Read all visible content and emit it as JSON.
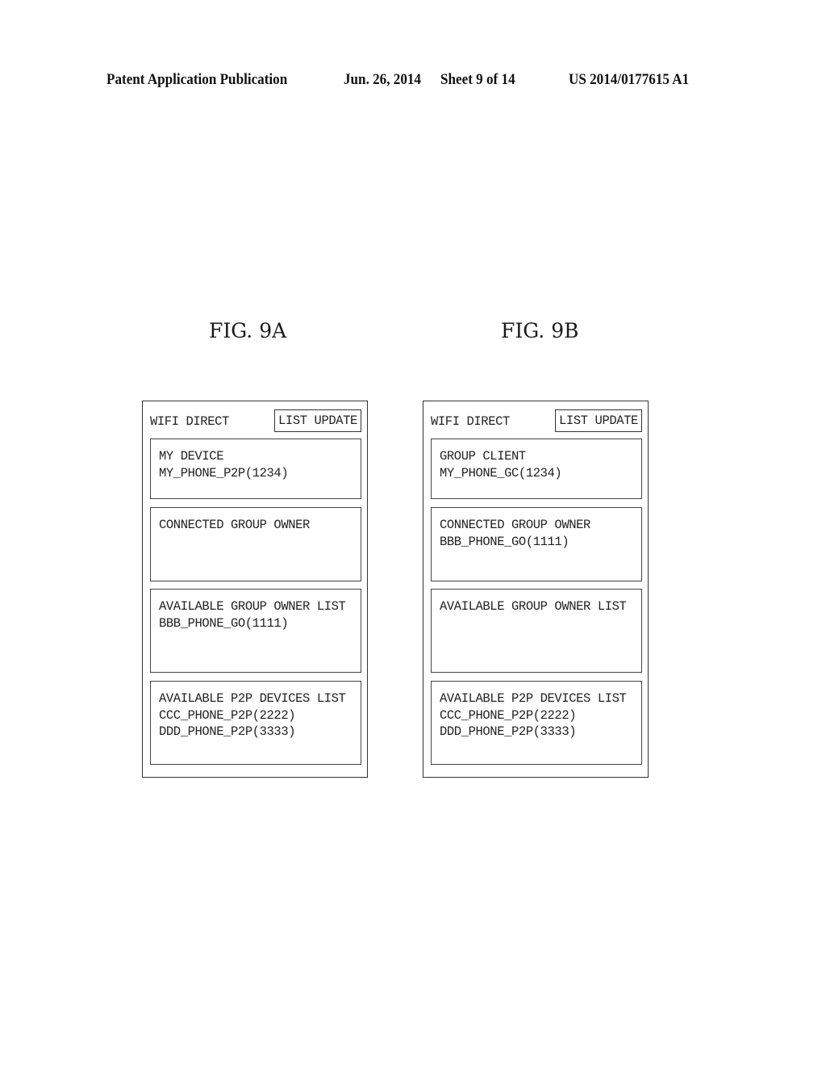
{
  "header": {
    "publication": "Patent Application Publication",
    "date": "Jun. 26, 2014",
    "sheet": "Sheet 9 of 14",
    "number": "US 2014/0177615 A1"
  },
  "figures": [
    {
      "label": "FIG. 9A",
      "app_title": "WIFI DIRECT",
      "list_update_label": "LIST UPDATE",
      "panels": [
        {
          "title": "MY DEVICE",
          "entries": [
            "MY_PHONE_P2P(1234)"
          ]
        },
        {
          "title": "CONNECTED GROUP OWNER",
          "entries": []
        },
        {
          "title": "AVAILABLE GROUP OWNER LIST",
          "entries": [
            "BBB_PHONE_GO(1111)"
          ]
        },
        {
          "title": "AVAILABLE P2P DEVICES LIST",
          "entries": [
            "CCC_PHONE_P2P(2222)",
            "DDD_PHONE_P2P(3333)"
          ]
        }
      ]
    },
    {
      "label": "FIG. 9B",
      "app_title": "WIFI DIRECT",
      "list_update_label": "LIST UPDATE",
      "panels": [
        {
          "title": "GROUP CLIENT",
          "entries": [
            "MY_PHONE_GC(1234)"
          ]
        },
        {
          "title": "CONNECTED GROUP OWNER",
          "entries": [
            "BBB_PHONE_GO(1111)"
          ]
        },
        {
          "title": "AVAILABLE GROUP OWNER LIST",
          "entries": []
        },
        {
          "title": "AVAILABLE P2P DEVICES LIST",
          "entries": [
            "CCC_PHONE_P2P(2222)",
            "DDD_PHONE_P2P(3333)"
          ]
        }
      ]
    }
  ]
}
